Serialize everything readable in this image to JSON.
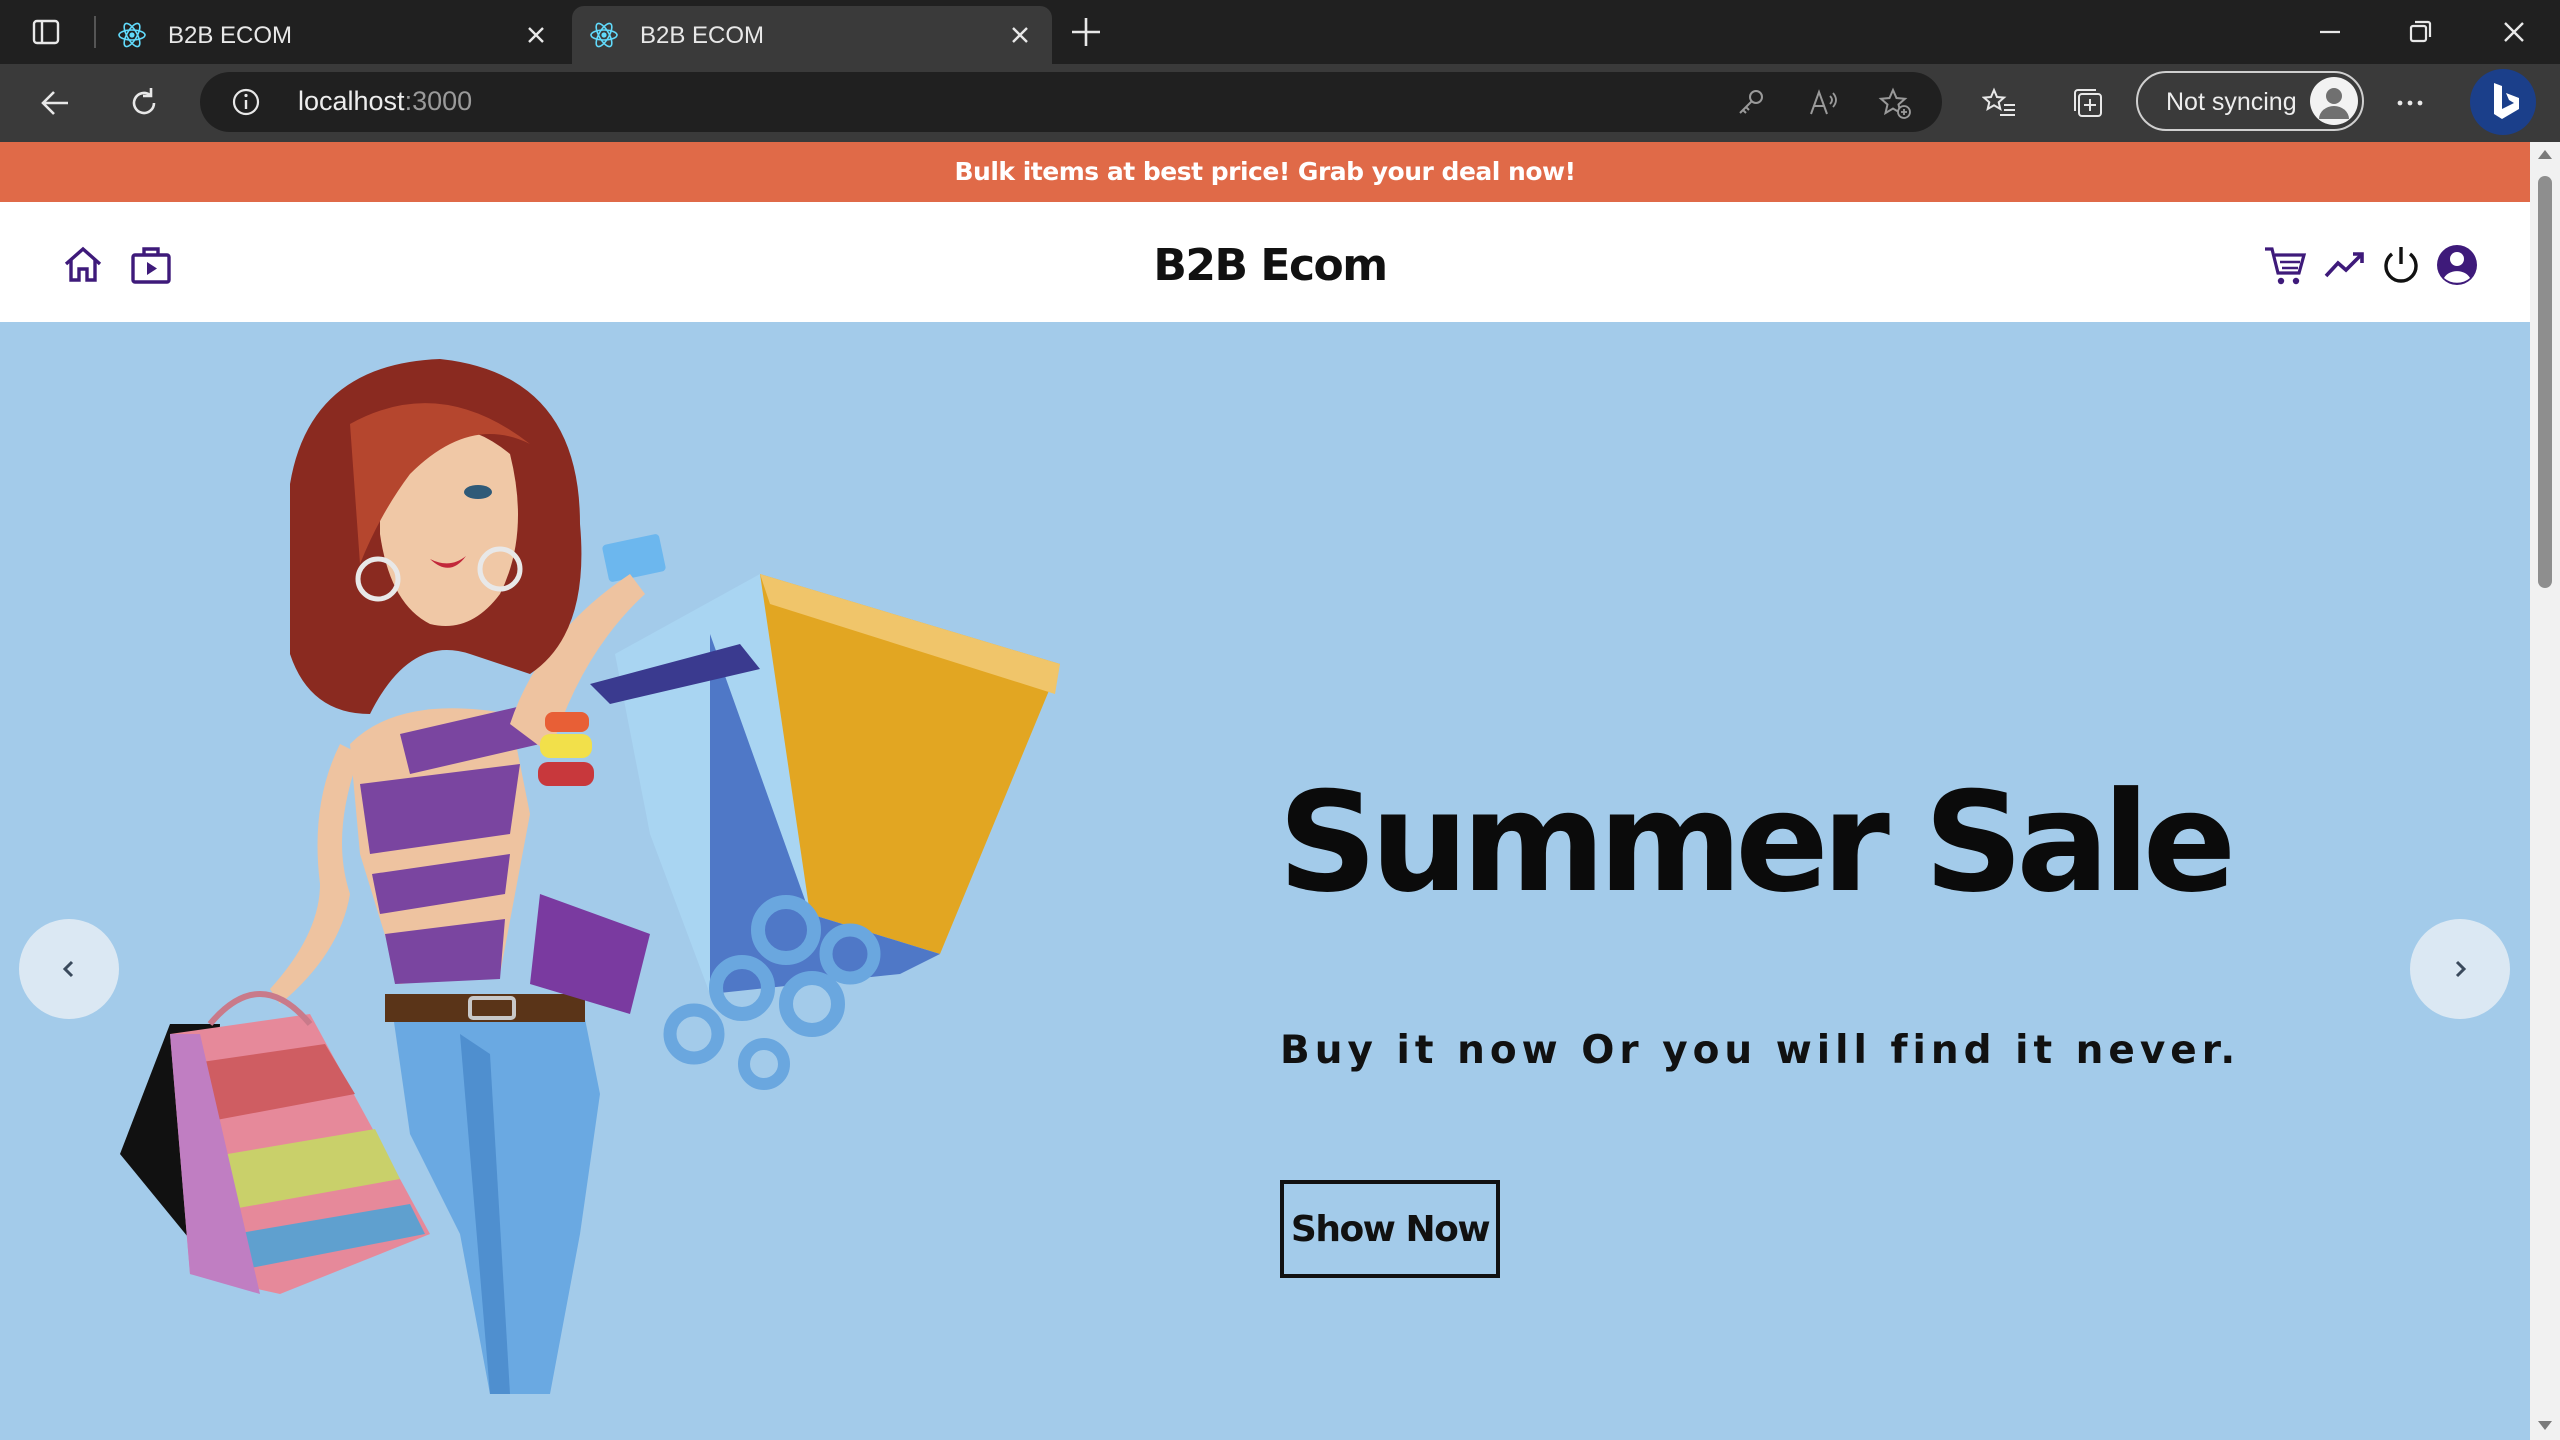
{
  "browser": {
    "tabs": [
      {
        "title": "B2B ECOM",
        "active": false
      },
      {
        "title": "B2B ECOM",
        "active": true
      }
    ],
    "address": {
      "host": "localhost",
      "port": ":3000"
    },
    "profile": {
      "label": "Not syncing"
    }
  },
  "page": {
    "announcement": "Bulk items at best price!  Grab your deal now!",
    "brand": "B2B Ecom",
    "nav_icons": {
      "left": [
        "home-icon",
        "shop-icon"
      ],
      "right": [
        "cart-icon",
        "trending-icon",
        "power-icon",
        "account-icon"
      ]
    },
    "slide": {
      "title": "Summer Sale",
      "subtitle": "Buy it now Or you will find it never.",
      "button": "Show Now",
      "image": "shopping-woman-illustration"
    }
  },
  "colors": {
    "announcement_bg": "#e06a48",
    "slide_bg": "#a3cbea",
    "nav_icon": "#3e1a7a",
    "chrome_dark": "#202020",
    "chrome_mid": "#3a3a3a"
  }
}
